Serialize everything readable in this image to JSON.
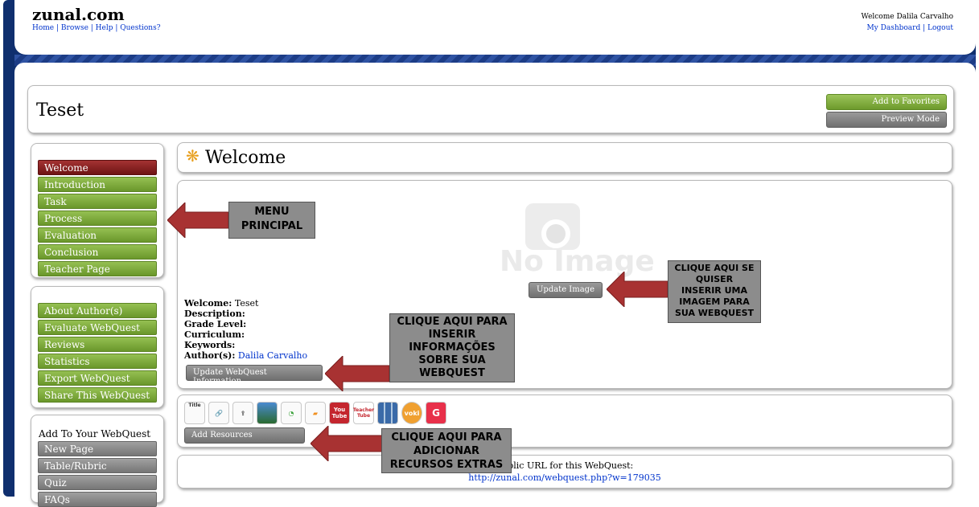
{
  "site": {
    "name": "zunal.com",
    "nav": [
      "Home",
      "Browse",
      "Help",
      "Questions?"
    ],
    "welcome_user": "Welcome Dalila Carvalho",
    "user_links": [
      "My Dashboard",
      "Logout"
    ]
  },
  "webquest": {
    "title": "Teset",
    "add_favorites": "Add to Favorites",
    "preview_mode": "Preview Mode"
  },
  "sidebar": {
    "menu": [
      "Welcome",
      "Introduction",
      "Task",
      "Process",
      "Evaluation",
      "Conclusion",
      "Teacher Page"
    ],
    "about": [
      "About Author(s)",
      "Evaluate WebQuest",
      "Reviews",
      "Statistics",
      "Export WebQuest",
      "Share This WebQuest"
    ],
    "add_heading": "Add To Your WebQuest",
    "add_items": [
      "New Page",
      "Table/Rubric",
      "Quiz",
      "FAQs"
    ]
  },
  "section": {
    "title": "Welcome",
    "no_image": "No Image",
    "update_image": "Update Image",
    "info": {
      "welcome_label": "Welcome:",
      "welcome_value": "Teset",
      "description_label": "Description:",
      "grade_label": "Grade Level:",
      "curriculum_label": "Curriculum:",
      "keywords_label": "Keywords:",
      "author_label": "Author(s):",
      "author_value": "Dalila Carvalho"
    },
    "update_info": "Update WebQuest Information"
  },
  "resources": {
    "icons": [
      "table-icon",
      "link-icon",
      "upload-icon",
      "image-icon",
      "chat-icon",
      "note-icon",
      "youtube-icon",
      "teachertube-icon",
      "slideshow-icon",
      "voki-icon",
      "glogster-icon"
    ],
    "icon_labels": [
      "Title",
      "www.",
      "",
      "",
      "",
      "",
      "You Tube",
      "Teacher Tube",
      "",
      "voki",
      "G"
    ],
    "add_resources": "Add Resources"
  },
  "public_url": {
    "label": "Public URL for this WebQuest:",
    "url": "http://zunal.com/webquest.php?w=179035"
  },
  "callouts": {
    "menu": "MENU\nPRINCIPAL",
    "image": "CLIQUE AQUI SE\nQUISER\nINSERIR UMA\nIMAGEM PARA\nSUA WEBQUEST",
    "info": "CLIQUE AQUI PARA\nINSERIR\nINFORMAÇÕES\nSOBRE SUA\nWEBQUEST",
    "resources": "CLIQUE AQUI PARA\nADICIONAR\nRECURSOS EXTRAS"
  },
  "colors": {
    "nav_blue": "#0f2f6e",
    "menu_green": "#7aa638",
    "menu_active": "#8b1e1e",
    "callout_gray": "#8c8c8c",
    "arrow_red": "#a83232"
  }
}
